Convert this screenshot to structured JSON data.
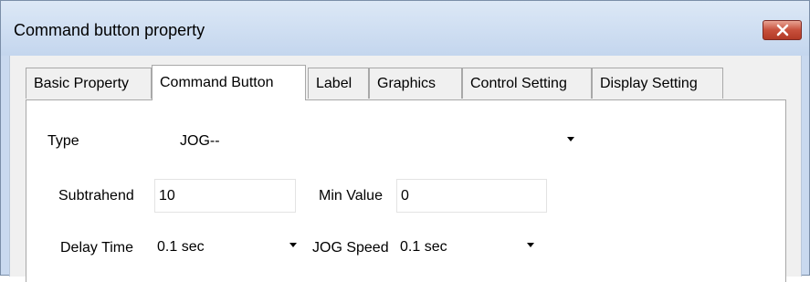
{
  "window": {
    "title": "Command button property",
    "close_icon": "close-icon",
    "colors": {
      "titlebar": "#c4d6ee",
      "close_button": "#c7503c",
      "panel": "#ffffff"
    }
  },
  "tabs": [
    {
      "label": "Basic Property",
      "active": false
    },
    {
      "label": "Command Button",
      "active": true
    },
    {
      "label": "Label",
      "active": false
    },
    {
      "label": "Graphics",
      "active": false
    },
    {
      "label": "Control Setting",
      "active": false
    },
    {
      "label": "Display Setting",
      "active": false
    }
  ],
  "form": {
    "type": {
      "label": "Type",
      "value": "JOG--"
    },
    "subtrahend": {
      "label": "Subtrahend",
      "value": "10"
    },
    "min_value": {
      "label": "Min Value",
      "value": "0"
    },
    "delay_time": {
      "label": "Delay Time",
      "value": "0.1 sec"
    },
    "jog_speed": {
      "label": "JOG Speed",
      "value": "0.1 sec"
    }
  }
}
